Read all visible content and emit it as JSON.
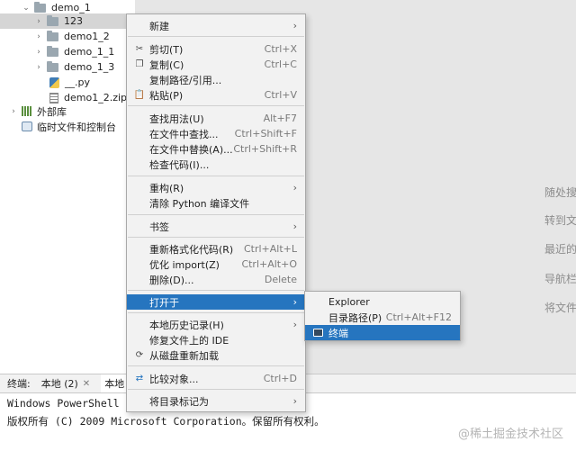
{
  "tree": {
    "items": [
      {
        "label": "demo_1",
        "type": "folder",
        "arrow": "⌄"
      },
      {
        "label": "123",
        "type": "folder",
        "arrow": "›"
      },
      {
        "label": "demo1_2",
        "type": "folder",
        "arrow": "›"
      },
      {
        "label": "demo_1_1",
        "type": "folder",
        "arrow": "›"
      },
      {
        "label": "demo_1_3",
        "type": "folder",
        "arrow": "›"
      },
      {
        "label": "__.py",
        "type": "py-file"
      },
      {
        "label": "demo1_2.zip",
        "type": "zip-file"
      },
      {
        "label": "外部库",
        "type": "library",
        "arrow": "›"
      },
      {
        "label": "临时文件和控制台",
        "type": "scratch"
      }
    ]
  },
  "editor_hints": [
    "随处搜",
    "转到文",
    "最近的",
    "导航栏",
    "将文件"
  ],
  "context_menu": {
    "items": [
      {
        "label": "新建",
        "submenu": true
      },
      {
        "label": "剪切(T)",
        "shortcut": "Ctrl+X",
        "icon": "scissors-icon"
      },
      {
        "label": "复制(C)",
        "shortcut": "Ctrl+C",
        "icon": "copy-icon"
      },
      {
        "label": "复制路径/引用..."
      },
      {
        "label": "粘贴(P)",
        "shortcut": "Ctrl+V",
        "icon": "paste-icon"
      },
      {
        "label": "查找用法(U)",
        "shortcut": "Alt+F7"
      },
      {
        "label": "在文件中查找...",
        "shortcut": "Ctrl+Shift+F"
      },
      {
        "label": "在文件中替换(A)...",
        "shortcut": "Ctrl+Shift+R"
      },
      {
        "label": "检查代码(I)..."
      },
      {
        "label": "重构(R)",
        "submenu": true
      },
      {
        "label": "清除 Python 编译文件"
      },
      {
        "label": "书签",
        "submenu": true
      },
      {
        "label": "重新格式化代码(R)",
        "shortcut": "Ctrl+Alt+L"
      },
      {
        "label": "优化 import(Z)",
        "shortcut": "Ctrl+Alt+O"
      },
      {
        "label": "删除(D)...",
        "shortcut": "Delete"
      },
      {
        "label": "打开于",
        "submenu": true,
        "highlighted": true
      },
      {
        "label": "本地历史记录(H)",
        "submenu": true
      },
      {
        "label": "修复文件上的 IDE"
      },
      {
        "label": "从磁盘重新加载",
        "icon": "reload-icon"
      },
      {
        "label": "比较对象...",
        "shortcut": "Ctrl+D",
        "icon": "compare-icon"
      },
      {
        "label": "将目录标记为",
        "submenu": true
      }
    ]
  },
  "open_in_submenu": {
    "items": [
      {
        "label": "Explorer"
      },
      {
        "label": "目录路径(P)",
        "shortcut": "Ctrl+Alt+F12"
      },
      {
        "label": "终端",
        "highlighted": true,
        "icon": "terminal-icon"
      }
    ]
  },
  "bottom_tabs": [
    {
      "label": "终端:"
    },
    {
      "label": "本地 (2)",
      "closable": true
    },
    {
      "label": "本地",
      "closable": true
    }
  ],
  "terminal_lines": [
    "Windows PowerShell",
    "版权所有 (C) 2009 Microsoft Corporation。保留所有权利。"
  ],
  "watermark": "@稀土掘金技术社区",
  "colors": {
    "highlight": "#2675bf",
    "menu_bg": "#f2f2f2",
    "editor_bg": "#e6e6e6",
    "selected_row": "#d5d5d5"
  }
}
